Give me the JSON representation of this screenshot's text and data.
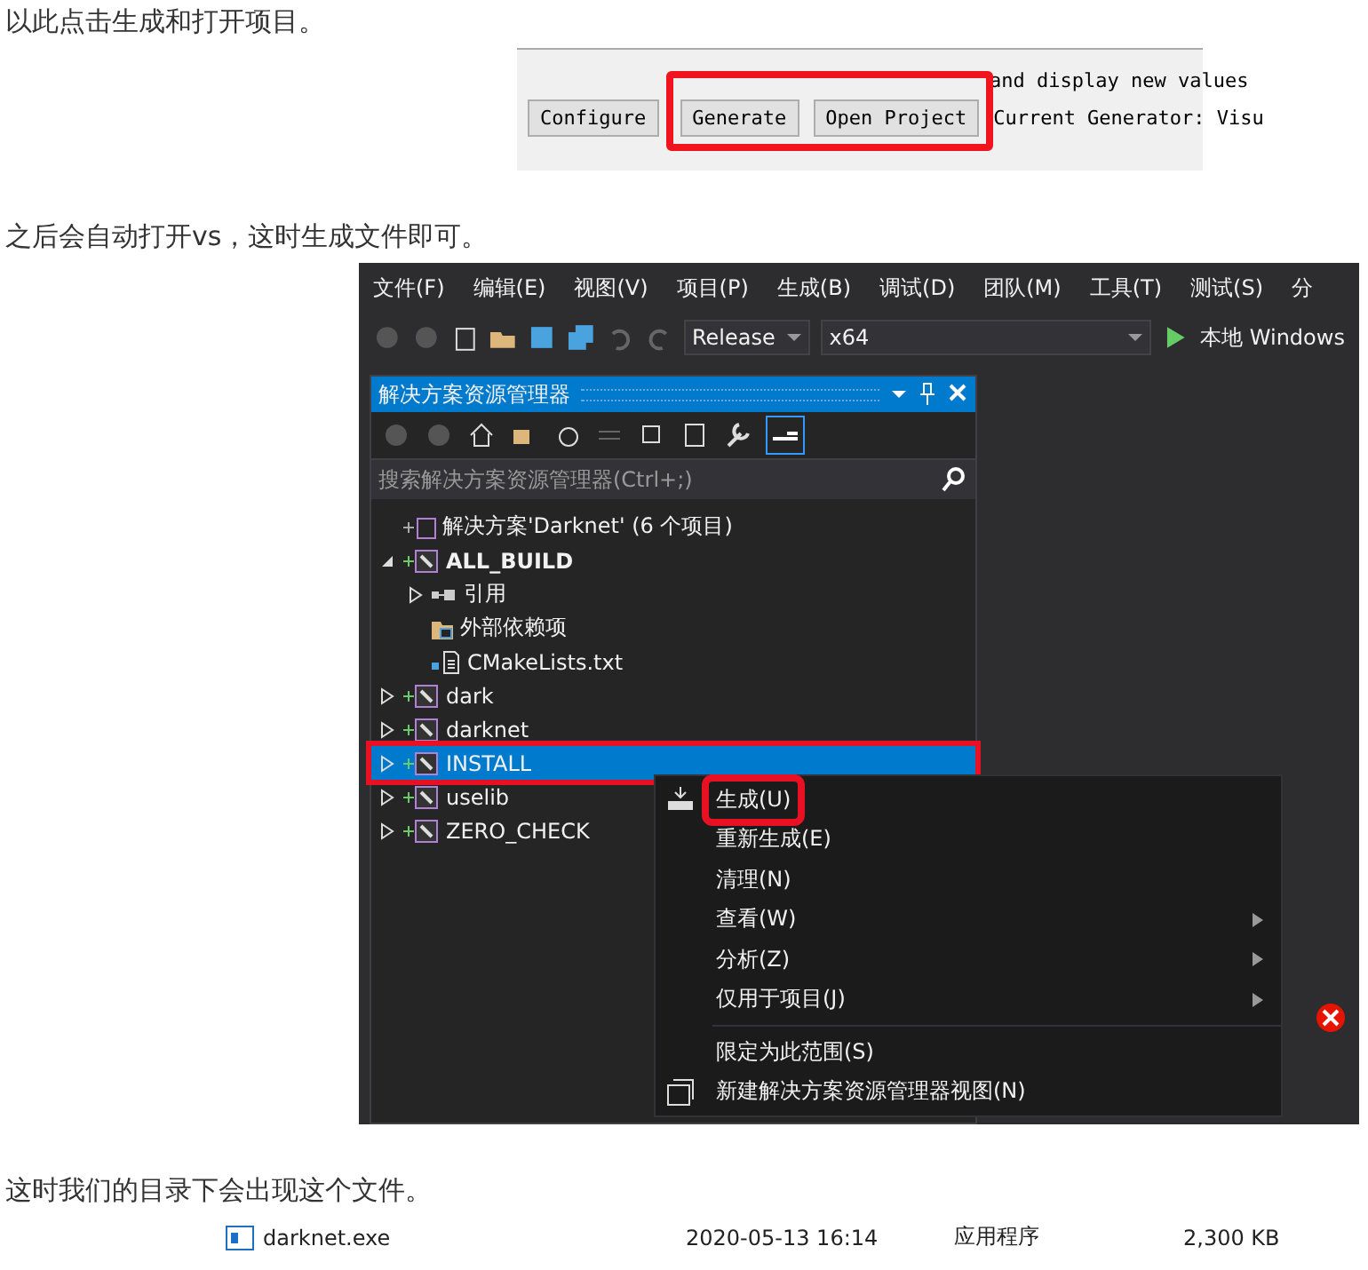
{
  "paragraphs": [
    "以此点击生成和打开项目。",
    "之后会自动打开vs，这时生成文件即可。",
    "这时我们的目录下会出现这个文件。"
  ],
  "cmake": {
    "hint": "and display new values",
    "buttons": [
      {
        "label": "Configure",
        "highlighted": false
      },
      {
        "label": "Generate",
        "highlighted": true
      },
      {
        "label": "Open Project",
        "highlighted": true
      }
    ],
    "generator": "Current Generator: Visu"
  },
  "vs": {
    "menu": [
      "文件(F)",
      "编辑(E)",
      "视图(V)",
      "项目(P)",
      "生成(B)",
      "调试(D)",
      "团队(M)",
      "工具(T)",
      "测试(S)",
      "分"
    ],
    "configuration": "Release",
    "platform": "x64",
    "run_label": "本地 Windows",
    "explorer": {
      "title": "解决方案资源管理器",
      "search_placeholder": "搜索解决方案资源管理器(Ctrl+;)",
      "tree": [
        {
          "label": "解决方案'Darknet' (6 个项目)",
          "kind": "solution",
          "children": [
            {
              "label": "ALL_BUILD",
              "kind": "project",
              "expanded": true,
              "selected": false,
              "highlighted": false,
              "children": [
                {
                  "label": "引用",
                  "kind": "references",
                  "expanded": false
                },
                {
                  "label": "外部依赖项",
                  "kind": "folder"
                },
                {
                  "label": "CMakeLists.txt",
                  "kind": "file"
                }
              ]
            },
            {
              "label": "dark",
              "kind": "project",
              "expanded": false,
              "selected": false,
              "highlighted": false
            },
            {
              "label": "darknet",
              "kind": "project",
              "expanded": false,
              "selected": false,
              "highlighted": false
            },
            {
              "label": "INSTALL",
              "kind": "project",
              "expanded": false,
              "selected": true,
              "highlighted": true
            },
            {
              "label": "uselib",
              "kind": "project",
              "expanded": false,
              "selected": false,
              "highlighted": false
            },
            {
              "label": "ZERO_CHECK",
              "kind": "project",
              "expanded": false,
              "selected": false,
              "highlighted": false
            }
          ]
        }
      ]
    },
    "context_menu": [
      {
        "kind": "build",
        "label": "生成(U)",
        "submenu": false,
        "highlighted": true
      },
      {
        "kind": "item",
        "label": "重新生成(E)",
        "submenu": false,
        "highlighted": false
      },
      {
        "kind": "item",
        "label": "清理(N)",
        "submenu": false,
        "highlighted": false
      },
      {
        "kind": "item",
        "label": "查看(W)",
        "submenu": true,
        "highlighted": false
      },
      {
        "kind": "item",
        "label": "分析(Z)",
        "submenu": true,
        "highlighted": false
      },
      {
        "kind": "item",
        "label": "仅用于项目(J)",
        "submenu": true,
        "highlighted": false
      },
      {
        "kind": "separator"
      },
      {
        "kind": "item",
        "label": "限定为此范围(S)",
        "submenu": false,
        "highlighted": false
      },
      {
        "kind": "view",
        "label": "新建解决方案资源管理器视图(N)",
        "submenu": false,
        "highlighted": false
      }
    ]
  },
  "file_row": {
    "name": "darknet.exe",
    "date": "2020-05-13 16:14",
    "type": "应用程序",
    "size": "2,300 KB"
  }
}
